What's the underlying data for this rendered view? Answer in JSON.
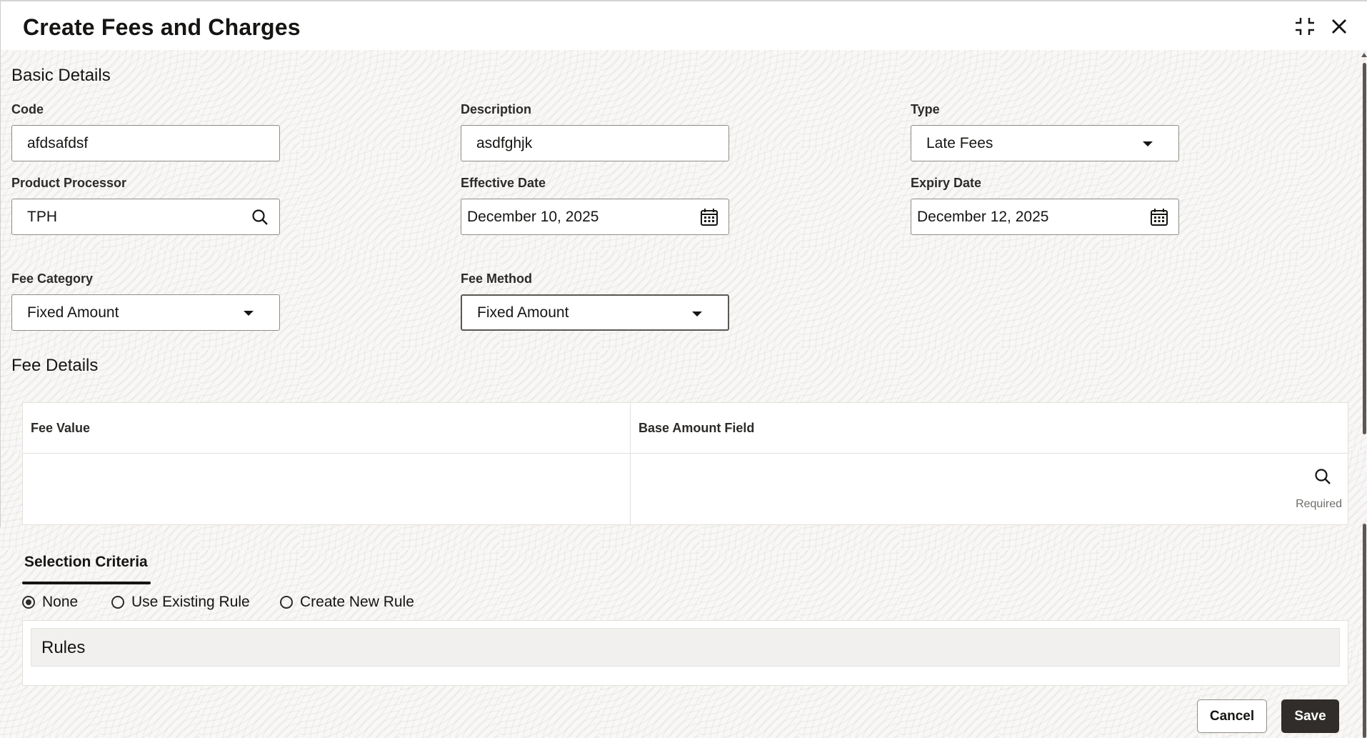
{
  "dialog": {
    "title": "Create Fees and Charges"
  },
  "basic_details": {
    "section_title": "Basic Details",
    "code": {
      "label": "Code",
      "value": "afdsafdsf"
    },
    "description": {
      "label": "Description",
      "value": "asdfghjk"
    },
    "type": {
      "label": "Type",
      "value": "Late Fees"
    },
    "product_processor": {
      "label": "Product Processor",
      "value": "TPH"
    },
    "effective_date": {
      "label": "Effective Date",
      "value": "December 10, 2025"
    },
    "expiry_date": {
      "label": "Expiry Date",
      "value": "December 12, 2025"
    },
    "fee_category": {
      "label": "Fee Category",
      "value": "Fixed Amount"
    },
    "fee_method": {
      "label": "Fee Method",
      "value": "Fixed Amount"
    }
  },
  "fee_details": {
    "section_title": "Fee Details",
    "columns": [
      "Fee Value",
      "Base Amount Field"
    ],
    "required_text": "Required"
  },
  "selection_criteria": {
    "tab_label": "Selection Criteria",
    "options": [
      {
        "label": "None",
        "selected": true
      },
      {
        "label": "Use Existing Rule",
        "selected": false
      },
      {
        "label": "Create New Rule",
        "selected": false
      }
    ],
    "rules_title": "Rules"
  },
  "footer": {
    "cancel_label": "Cancel",
    "save_label": "Save"
  },
  "icons": {
    "collapse": "collapse-icon",
    "close": "close-icon",
    "search": "search-icon",
    "calendar": "calendar-icon",
    "dropdown": "chevron-down-icon"
  }
}
